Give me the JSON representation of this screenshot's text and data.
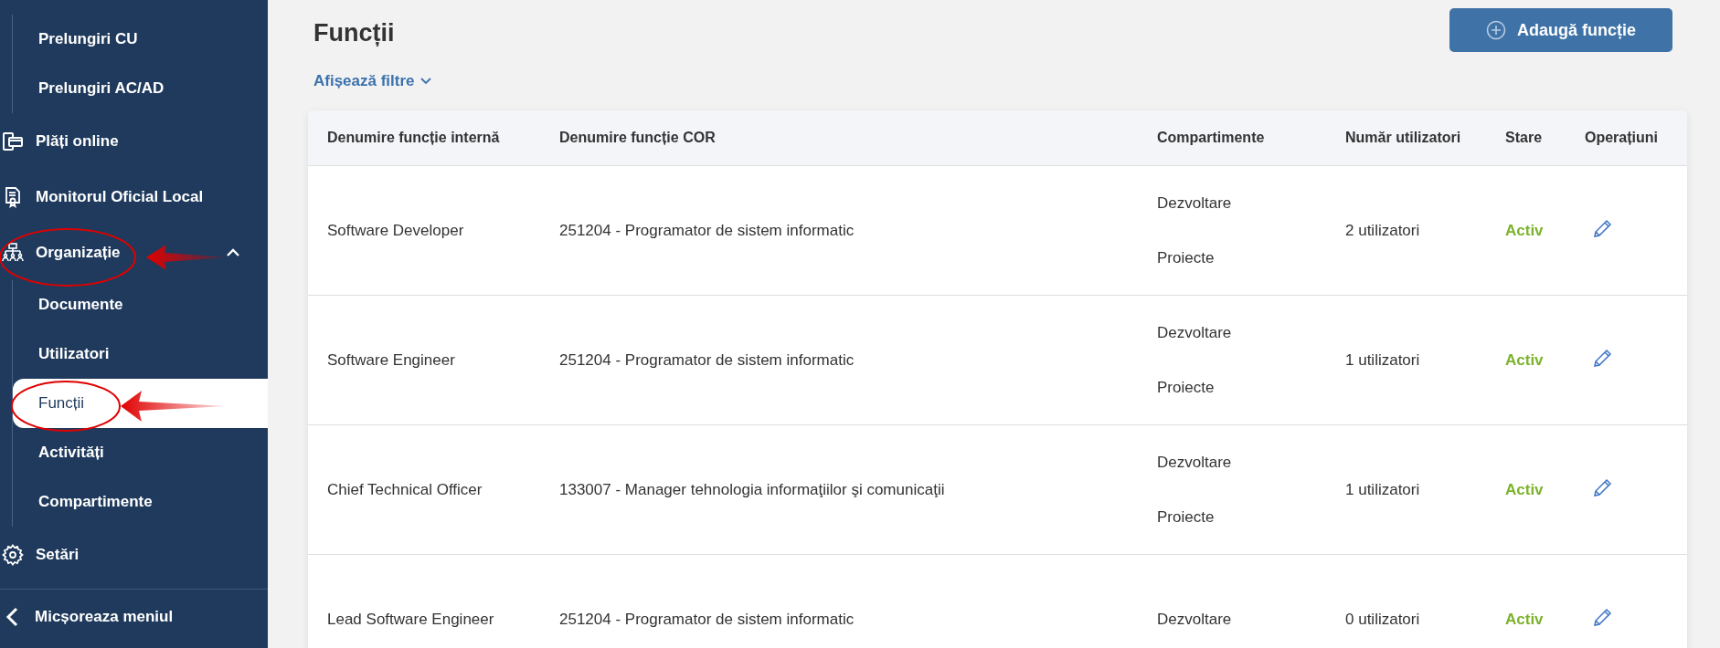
{
  "sidebar": {
    "items": [
      {
        "kind": "group",
        "children": [
          {
            "label": "Prelungiri CU",
            "selected": false
          },
          {
            "label": "Prelungiri AC/AD",
            "selected": false
          }
        ]
      },
      {
        "kind": "item",
        "label": "Plăți online"
      },
      {
        "kind": "item",
        "label": "Monitorul Oficial Local"
      },
      {
        "kind": "item",
        "label": "Organizație",
        "expanded": true,
        "children": [
          {
            "label": "Documente",
            "selected": false
          },
          {
            "label": "Utilizatori",
            "selected": false
          },
          {
            "label": "Funcții",
            "selected": true
          },
          {
            "label": "Activități",
            "selected": false
          },
          {
            "label": "Compartimente",
            "selected": false
          }
        ]
      },
      {
        "kind": "item",
        "label": "Setări"
      }
    ],
    "collapse_menu": {
      "label": "Micșoreaza meniul"
    }
  },
  "page": {
    "title": "Funcții",
    "add_button": "Adaugă funcție",
    "filters_link": "Afișează filtre"
  },
  "table": {
    "columns": [
      "Denumire funcție internă",
      "Denumire funcție COR",
      "Compartimente",
      "Număr utilizatori",
      "Stare",
      "Operațiuni"
    ],
    "rows": [
      {
        "name": "Software Developer",
        "cor": "251204 - Programator de sistem informatic",
        "departments": [
          "Dezvoltare",
          "Proiecte"
        ],
        "users": "2 utilizatori",
        "status": {
          "kind": "active",
          "label": "Activ"
        }
      },
      {
        "name": "Software Engineer",
        "cor": "251204 - Programator de sistem informatic",
        "departments": [
          "Dezvoltare",
          "Proiecte"
        ],
        "users": "1 utilizatori",
        "status": {
          "kind": "active",
          "label": "Activ"
        }
      },
      {
        "name": "Chief Technical Officer",
        "cor": "133007 - Manager tehnologia informaţiilor şi comunicaţii",
        "departments": [
          "Dezvoltare",
          "Proiecte"
        ],
        "users": "1 utilizatori",
        "status": {
          "kind": "active",
          "label": "Activ"
        }
      },
      {
        "name": "Lead Software Engineer",
        "cor": "251204 - Programator de sistem informatic",
        "departments": [
          "Dezvoltare"
        ],
        "users": "0 utilizatori",
        "status": {
          "kind": "active",
          "label": "Activ"
        }
      }
    ]
  }
}
